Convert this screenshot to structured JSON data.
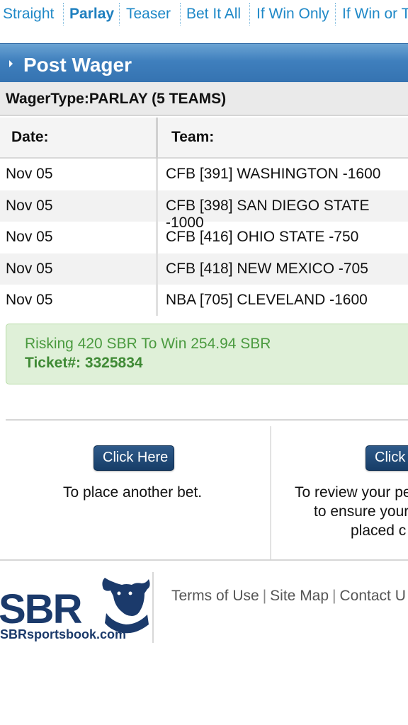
{
  "tabs": [
    {
      "label": "Straight",
      "active": false
    },
    {
      "label": "Parlay",
      "active": true
    },
    {
      "label": "Teaser",
      "active": false
    },
    {
      "label": "Bet It All",
      "active": false
    },
    {
      "label": "If Win Only",
      "active": false
    },
    {
      "label": "If Win or T",
      "active": false
    }
  ],
  "header": {
    "title": "Post Wager"
  },
  "wager_type": "WagerType:PARLAY (5 TEAMS)",
  "table": {
    "headers": {
      "date": "Date:",
      "team": "Team:"
    },
    "rows": [
      {
        "date": "Nov 05",
        "team": "CFB [391] WASHINGTON -1600"
      },
      {
        "date": "Nov 05",
        "team": "CFB [398] SAN DIEGO STATE -1000"
      },
      {
        "date": "Nov 05",
        "team": "CFB [416] OHIO STATE -750"
      },
      {
        "date": "Nov 05",
        "team": "CFB [418] NEW MEXICO -705"
      },
      {
        "date": "Nov 05",
        "team": "NBA [705] CLEVELAND -1600"
      }
    ]
  },
  "confirmation": {
    "risk_text": "Risking 420 SBR To Win 254.94 SBR",
    "ticket_text": "Ticket#: 3325834"
  },
  "actions": {
    "left": {
      "button": "Click Here",
      "text": "To place another bet."
    },
    "right": {
      "button": "Click",
      "line1": "To review your pe",
      "line2": "to ensure your",
      "line3": "placed c"
    }
  },
  "footer": {
    "logo_main": "SBR",
    "logo_sub": "SBRsportsbook.com",
    "links": [
      "Terms of Use",
      "Site Map",
      "Contact U"
    ]
  },
  "colors": {
    "tab_link": "#1e88c7",
    "header_blue": "#3f7fbd",
    "confirm_bg": "#dff0d8",
    "confirm_text": "#4a9a3f",
    "button_navy": "#173d68",
    "logo_navy": "#1b3a6b"
  }
}
